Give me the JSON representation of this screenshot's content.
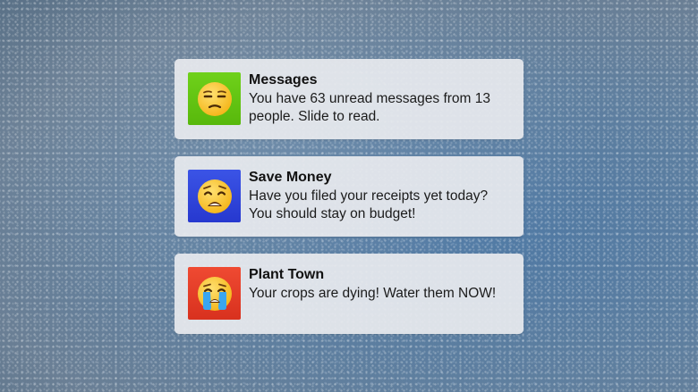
{
  "notifications": [
    {
      "app": "Messages",
      "body": "You have 63 unread messages from 13 people. Slide to read.",
      "icon": "unamused-face-icon",
      "icon_bg": "#62c515"
    },
    {
      "app": "Save Money",
      "body": "Have you filed your receipts yet today? You should stay on budget!",
      "icon": "weary-face-icon",
      "icon_bg": "#2f45dc"
    },
    {
      "app": "Plant Town",
      "body": "Your crops are dying! Water them NOW!",
      "icon": "crying-face-icon",
      "icon_bg": "#e33d28"
    }
  ]
}
